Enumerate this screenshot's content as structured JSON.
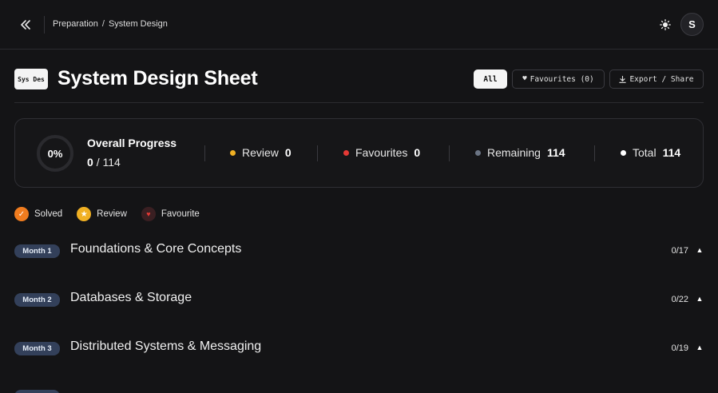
{
  "breadcrumb": {
    "parent": "Preparation",
    "separator": "/",
    "current": "System Design"
  },
  "user": {
    "avatar_initial": "S"
  },
  "header": {
    "badge": "Sys Des",
    "title": "System Design Sheet"
  },
  "filters": {
    "all_label": "All",
    "favourites_label": "Favourites (0)",
    "export_label": "Export / Share"
  },
  "progress": {
    "percent_label": "0%",
    "percent": 0,
    "title": "Overall Progress",
    "solved": "0",
    "total_separator": "/ 114",
    "stats": [
      {
        "label": "Review",
        "value": "0",
        "color": "#f0b023"
      },
      {
        "label": "Favourites",
        "value": "0",
        "color": "#e53935"
      },
      {
        "label": "Remaining",
        "value": "114",
        "color": "#6b7484"
      },
      {
        "label": "Total",
        "value": "114",
        "color": "#ffffff"
      }
    ]
  },
  "legend": [
    {
      "label": "Solved",
      "icon": "check-icon",
      "color": "#f07c1f"
    },
    {
      "label": "Review",
      "icon": "star-icon",
      "color": "#f0b023"
    },
    {
      "label": "Favourite",
      "icon": "heart-icon",
      "color": "#3a1f22"
    }
  ],
  "months": [
    {
      "badge": "Month 1",
      "title": "Foundations & Core Concepts",
      "count": "0/17"
    },
    {
      "badge": "Month 2",
      "title": "Databases & Storage",
      "count": "0/22"
    },
    {
      "badge": "Month 3",
      "title": "Distributed Systems & Messaging",
      "count": "0/19"
    }
  ],
  "colors": {
    "background": "#141416",
    "accent_badge": "#33405a"
  }
}
